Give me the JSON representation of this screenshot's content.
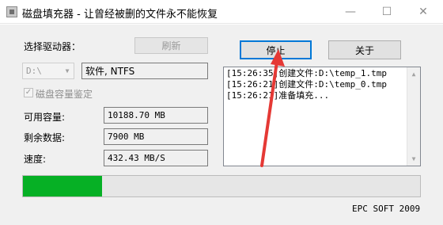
{
  "window": {
    "title": "磁盘填充器 - 让曾经被删的文件永不能恢复",
    "controls": {
      "minimize": "—",
      "maximize": "☐",
      "close": "✕"
    }
  },
  "drive": {
    "label": "选择驱动器：",
    "refresh_label": "刷新",
    "selected": "D:\\",
    "fs_info": "软件, NTFS"
  },
  "capacity_check": {
    "label": "磁盘容量鉴定",
    "checked": true
  },
  "stats": {
    "available_label": "可用容量:",
    "available_value": "10188.70 MB",
    "remaining_label": "剩余数据:",
    "remaining_value": "7900 MB",
    "speed_label": "速度:",
    "speed_value": "432.43 MB/S"
  },
  "actions": {
    "stop_label": "停止",
    "about_label": "关于"
  },
  "log": [
    "[15:26:35]创建文件:D:\\temp_1.tmp",
    "[15:26:21]创建文件:D:\\temp_0.tmp",
    "[15:26:21]准备填充..."
  ],
  "progress": {
    "fraction": 0.2
  },
  "footer": "EPC SOFT 2009",
  "colors": {
    "progress": "#06b025",
    "focus": "#0078d7"
  }
}
